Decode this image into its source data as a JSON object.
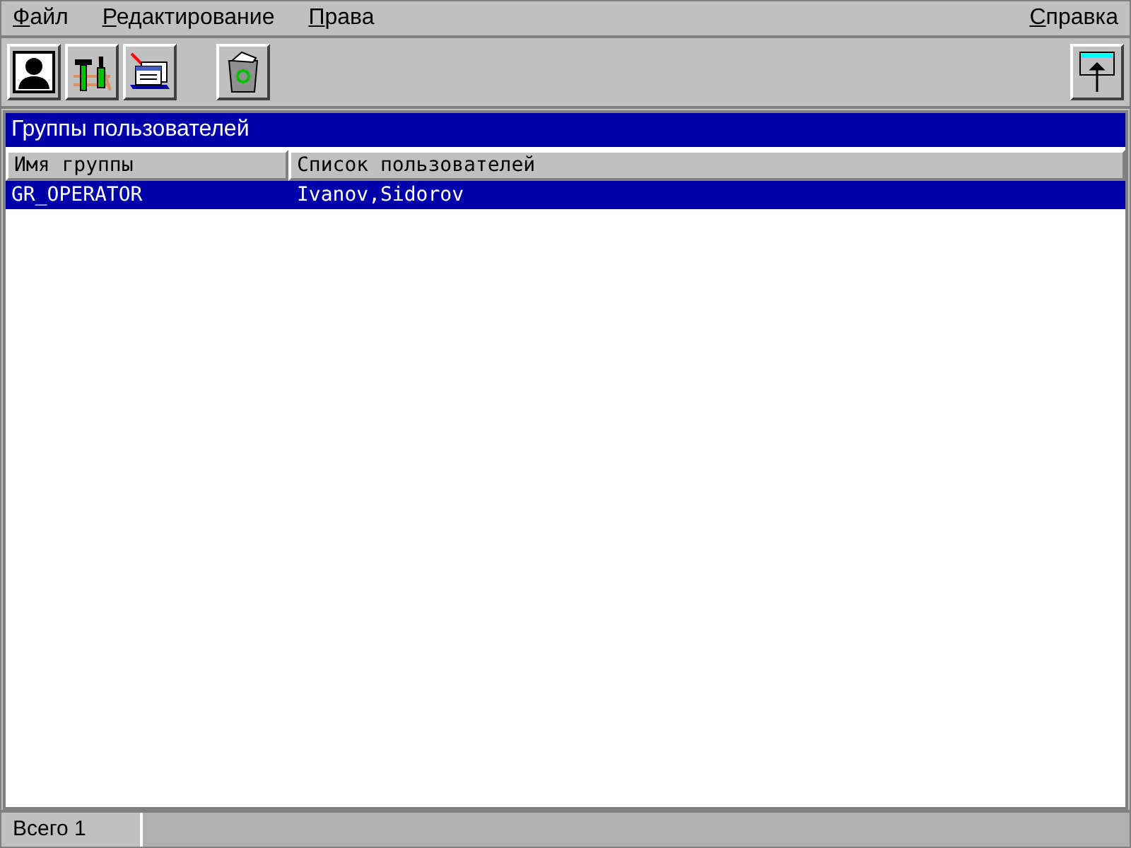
{
  "menu": [
    "Файл",
    "Редактирование",
    "Права"
  ],
  "help_menu": "Справка",
  "toolbar": {
    "groups": [
      [
        {
          "kind": "user"
        },
        {
          "kind": "tools"
        },
        {
          "kind": "cards"
        }
      ],
      [
        {
          "kind": "trash"
        }
      ]
    ],
    "right": [
      {
        "kind": "window"
      }
    ]
  },
  "panel": {
    "title": "Группы пользователей"
  },
  "table": {
    "columns": [
      "Имя группы",
      "Список пользователей"
    ],
    "rows": [
      {
        "cells": [
          "GR_OPERATOR",
          "Ivanov,Sidorov"
        ],
        "selected": true
      }
    ]
  },
  "status_bar": {
    "text": "Всего 1"
  }
}
